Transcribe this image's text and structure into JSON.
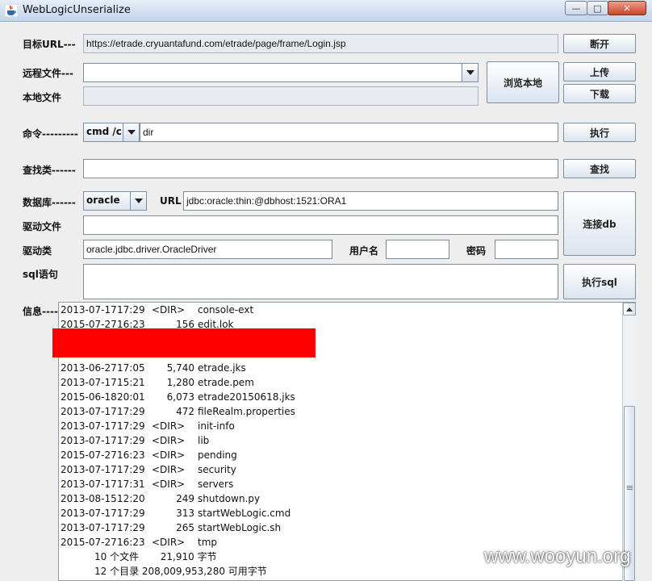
{
  "window": {
    "title": "WebLogicUnserialize",
    "minimize_glyph": "—",
    "maximize_glyph": "□",
    "close_glyph": "✕"
  },
  "target": {
    "label": "目标URL---",
    "value": "https://etrade.cryuantafund.com/etrade/page/frame/Login.jsp",
    "disconnect_button": "断开"
  },
  "remote_file": {
    "label": "远程文件---",
    "value": "",
    "browse_button": "浏览本地",
    "upload_button": "上传",
    "download_button": "下载"
  },
  "local_file": {
    "label": "本地文件",
    "value": ""
  },
  "command": {
    "label": "命令---------",
    "shell": "cmd /c",
    "value": "dir",
    "execute_button": "执行"
  },
  "find_class": {
    "label": "查找类------",
    "value": "",
    "find_button": "查找"
  },
  "database": {
    "label": "数据库------",
    "db_type": "oracle",
    "url_label": "URL",
    "url_value": "jdbc:oracle:thin:@dbhost:1521:ORA1",
    "driver_file_label": "驱动文件",
    "driver_file_value": "",
    "driver_class_label": "驱动类",
    "driver_class_value": "oracle.jdbc.driver.OracleDriver",
    "username_label": "用户名",
    "username_value": "",
    "password_label": "密码",
    "password_value": "",
    "connect_button": "连接db"
  },
  "sql": {
    "label": "sql语句",
    "value": "",
    "execute_button": "执行sql"
  },
  "info": {
    "label": "信息----",
    "lines": [
      {
        "date": "2013-07-17",
        "time": "17:29",
        "dir": "<DIR>",
        "size": "",
        "name": "console-ext"
      },
      {
        "date": "2015-07-27",
        "time": "16:23",
        "dir": "",
        "size": "156",
        "name": "edit.lok"
      },
      {
        "date": "",
        "time": "",
        "dir": "",
        "size": "",
        "name": ""
      },
      {
        "date": "",
        "time": "",
        "dir": "",
        "size": "",
        "name": ""
      },
      {
        "date": "2013-06-27",
        "time": "17:05",
        "dir": "",
        "size": "5,740",
        "name": "etrade.jks"
      },
      {
        "date": "2013-07-17",
        "time": "15:21",
        "dir": "",
        "size": "1,280",
        "name": "etrade.pem"
      },
      {
        "date": "2015-06-18",
        "time": "20:01",
        "dir": "",
        "size": "6,073",
        "name": "etrade20150618.jks"
      },
      {
        "date": "2013-07-17",
        "time": "17:29",
        "dir": "",
        "size": "472",
        "name": "fileRealm.properties"
      },
      {
        "date": "2013-07-17",
        "time": "17:29",
        "dir": "<DIR>",
        "size": "",
        "name": "init-info"
      },
      {
        "date": "2013-07-17",
        "time": "17:29",
        "dir": "<DIR>",
        "size": "",
        "name": "lib"
      },
      {
        "date": "2015-07-27",
        "time": "16:23",
        "dir": "<DIR>",
        "size": "",
        "name": "pending"
      },
      {
        "date": "2013-07-17",
        "time": "17:29",
        "dir": "<DIR>",
        "size": "",
        "name": "security"
      },
      {
        "date": "2013-07-17",
        "time": "17:31",
        "dir": "<DIR>",
        "size": "",
        "name": "servers"
      },
      {
        "date": "2013-08-15",
        "time": "12:20",
        "dir": "",
        "size": "249",
        "name": "shutdown.py"
      },
      {
        "date": "2013-07-17",
        "time": "17:29",
        "dir": "",
        "size": "313",
        "name": "startWebLogic.cmd"
      },
      {
        "date": "2013-07-17",
        "time": "17:29",
        "dir": "",
        "size": "265",
        "name": "startWebLogic.sh"
      },
      {
        "date": "2015-07-27",
        "time": "16:23",
        "dir": "<DIR>",
        "size": "",
        "name": "tmp"
      }
    ],
    "summary_files": "10 个文件       21,910 字节",
    "summary_dirs": "12 个目录 208,009,953,280 可用字节"
  },
  "watermark": "www.wooyun.org",
  "colors": {
    "redaction": "#ff0000"
  }
}
